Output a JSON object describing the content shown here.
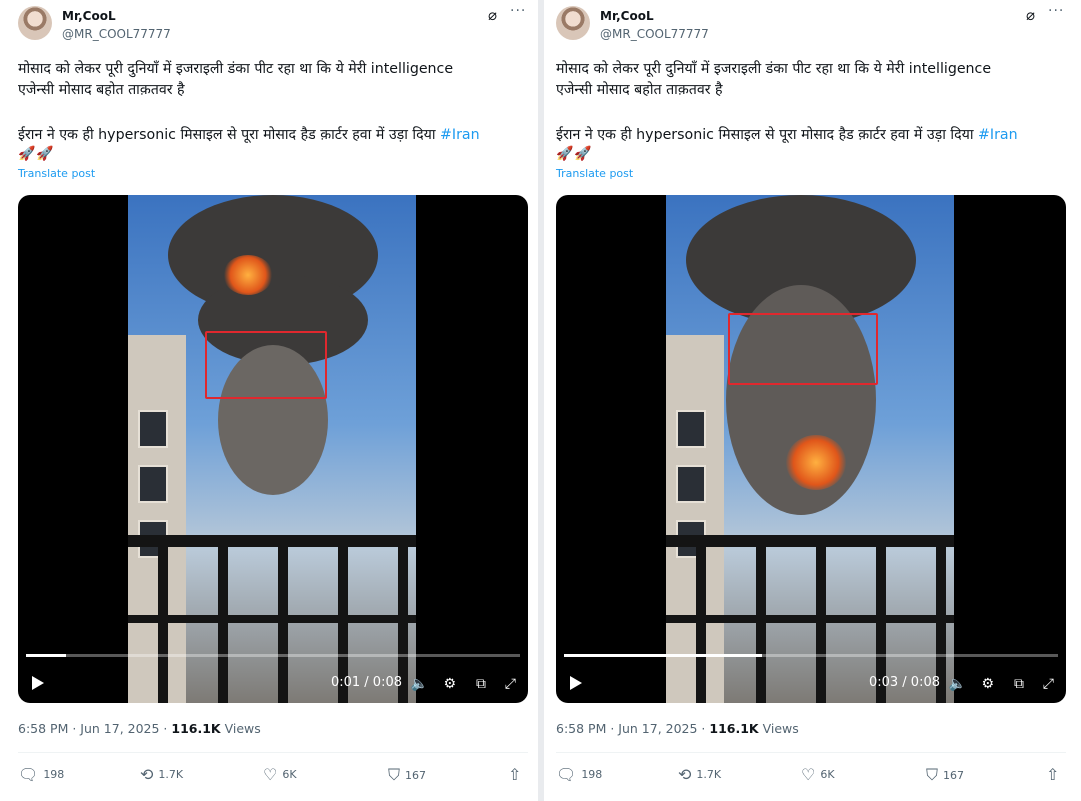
{
  "colors": {
    "accent": "#1d9bf0",
    "text": "#0f1419",
    "muted": "#536471",
    "annotation": "#e0282e"
  },
  "posts": [
    {
      "author": {
        "name": "Mr,CooL",
        "handle": "@MR_COOL77777"
      },
      "icons": {
        "grok": "grok-icon",
        "more": "more-icon"
      },
      "text": {
        "line1": "मोसाद को लेकर पूरी दुनियाँ में इजराइली डंका पीट रहा था कि ये मेरी intelligence",
        "line2": "एजेन्सी मोसाद बहोत ताक़तवर है",
        "line3": "ईरान ने एक ही hypersonic मिसाइल से पूरा मोसाद हैड क़ार्टर हवा में उड़ा दिया ",
        "hashtag": "#Iran",
        "emoji": "🚀🚀"
      },
      "translate_label": "Translate post",
      "video": {
        "time": "0:01 / 0:08",
        "progress": 0.08
      },
      "meta": {
        "time": "6:58 PM · Jun 17, 2025 · ",
        "views_count": "116.1K",
        "views_label": " Views"
      },
      "stats": {
        "replies": "198",
        "reposts": "1.7K",
        "likes": "6K",
        "bookmarks": "167"
      }
    },
    {
      "author": {
        "name": "Mr,CooL",
        "handle": "@MR_COOL77777"
      },
      "icons": {
        "grok": "grok-icon",
        "more": "more-icon"
      },
      "text": {
        "line1": "मोसाद को लेकर पूरी दुनियाँ में इजराइली डंका पीट रहा था कि ये मेरी intelligence",
        "line2": "एजेन्सी मोसाद बहोत ताक़तवर है",
        "line3": "ईरान ने एक ही hypersonic मिसाइल से पूरा मोसाद हैड क़ार्टर हवा में उड़ा दिया ",
        "hashtag": "#Iran",
        "emoji": "🚀🚀"
      },
      "translate_label": "Translate post",
      "video": {
        "time": "0:03 / 0:08",
        "progress": 0.4
      },
      "meta": {
        "time": "6:58 PM · Jun 17, 2025 · ",
        "views_count": "116.1K",
        "views_label": " Views"
      },
      "stats": {
        "replies": "198",
        "reposts": "1.7K",
        "likes": "6K",
        "bookmarks": "167"
      }
    }
  ]
}
